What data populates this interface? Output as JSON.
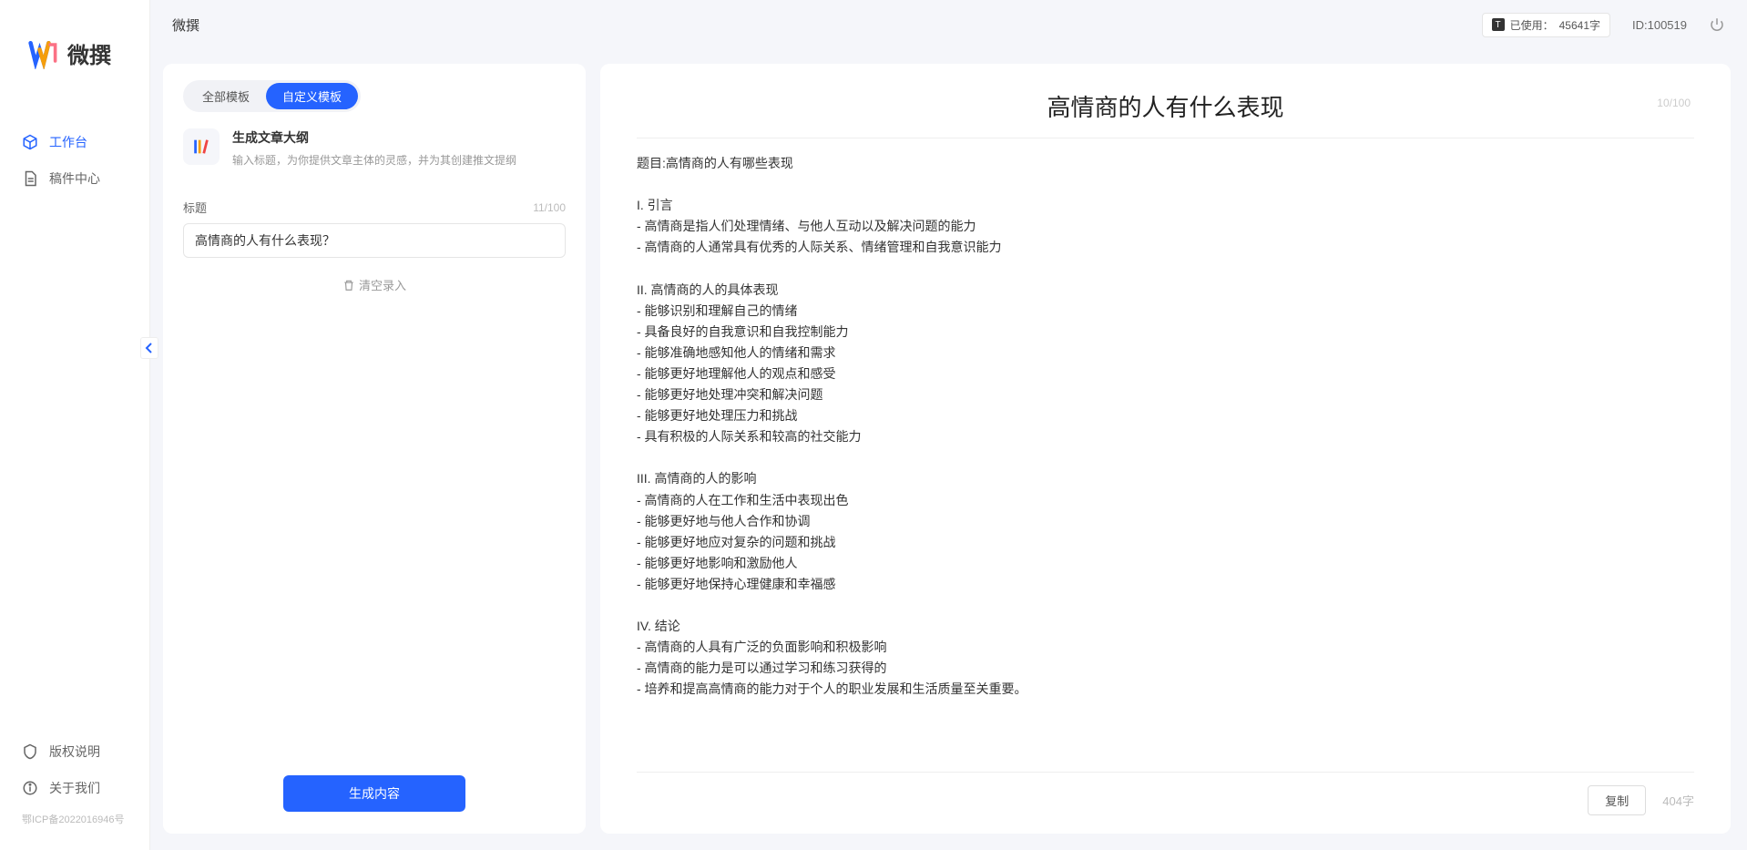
{
  "brand": {
    "name": "微撰"
  },
  "topbar": {
    "title": "微撰",
    "usage_prefix": "已使用：",
    "usage_value": "45641字",
    "id_label": "ID:100519"
  },
  "sidebar": {
    "nav": [
      {
        "label": "工作台",
        "active": true,
        "icon": "cube"
      },
      {
        "label": "稿件中心",
        "active": false,
        "icon": "doc"
      }
    ],
    "bottom": [
      {
        "label": "版权说明",
        "icon": "shield"
      },
      {
        "label": "关于我们",
        "icon": "info"
      }
    ],
    "icp": "鄂ICP备2022016946号"
  },
  "left": {
    "tabs": [
      {
        "label": "全部模板",
        "active": false
      },
      {
        "label": "自定义模板",
        "active": true
      }
    ],
    "template": {
      "name": "生成文章大纲",
      "desc": "输入标题，为你提供文章主体的灵感，并为其创建推文提纲"
    },
    "field": {
      "label": "标题",
      "counter": "11/100",
      "value": "高情商的人有什么表现？"
    },
    "clear": "清空录入",
    "generate": "生成内容"
  },
  "right": {
    "title": "高情商的人有什么表现",
    "top_counter": "10/100",
    "body": "题目:高情商的人有哪些表现\n\nI. 引言\n- 高情商是指人们处理情绪、与他人互动以及解决问题的能力\n- 高情商的人通常具有优秀的人际关系、情绪管理和自我意识能力\n\nII. 高情商的人的具体表现\n- 能够识别和理解自己的情绪\n- 具备良好的自我意识和自我控制能力\n- 能够准确地感知他人的情绪和需求\n- 能够更好地理解他人的观点和感受\n- 能够更好地处理冲突和解决问题\n- 能够更好地处理压力和挑战\n- 具有积极的人际关系和较高的社交能力\n\nIII. 高情商的人的影响\n- 高情商的人在工作和生活中表现出色\n- 能够更好地与他人合作和协调\n- 能够更好地应对复杂的问题和挑战\n- 能够更好地影响和激励他人\n- 能够更好地保持心理健康和幸福感\n\nIV. 结论\n- 高情商的人具有广泛的负面影响和积极影响\n- 高情商的能力是可以通过学习和练习获得的\n- 培养和提高高情商的能力对于个人的职业发展和生活质量至关重要。",
    "copy": "复制",
    "word_count": "404字"
  }
}
